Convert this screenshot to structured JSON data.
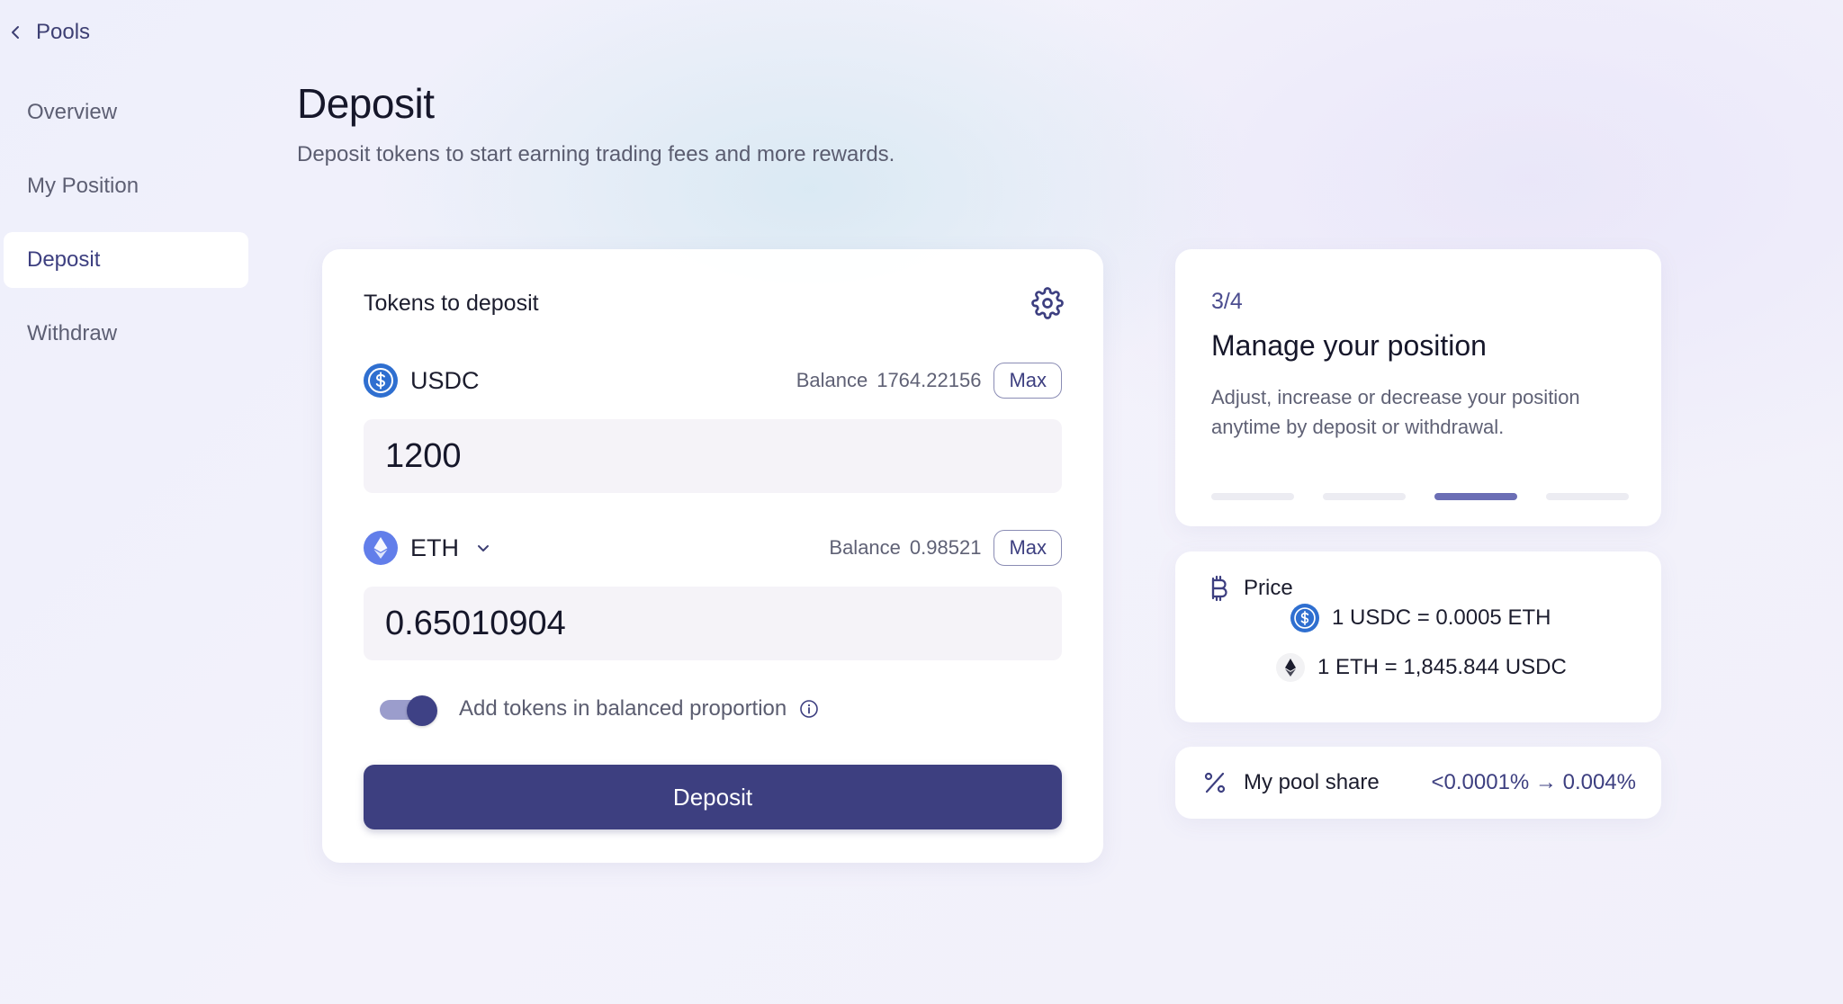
{
  "nav": {
    "back_label": "Pools",
    "items": [
      {
        "label": "Overview",
        "active": false
      },
      {
        "label": "My Position",
        "active": false
      },
      {
        "label": "Deposit",
        "active": true
      },
      {
        "label": "Withdraw",
        "active": false
      }
    ]
  },
  "header": {
    "title": "Deposit",
    "subtitle": "Deposit tokens to start earning trading fees and more rewards."
  },
  "deposit_card": {
    "heading": "Tokens to deposit",
    "token_a": {
      "symbol": "USDC",
      "balance_label": "Balance",
      "balance": "1764.22156",
      "max_label": "Max",
      "amount": "1200",
      "icon": "usdc-icon"
    },
    "token_b": {
      "symbol": "ETH",
      "balance_label": "Balance",
      "balance": "0.98521",
      "max_label": "Max",
      "amount": "0.65010904",
      "icon": "eth-icon"
    },
    "balanced_label": "Add tokens in balanced proportion",
    "balanced_enabled": true,
    "deposit_button": "Deposit"
  },
  "step_card": {
    "step": "3/4",
    "title": "Manage your position",
    "description": "Adjust, increase or decrease your position anytime by deposit or withdrawal.",
    "total_steps": 4,
    "current_step": 3
  },
  "price_card": {
    "title": "Price",
    "rate_1": "1 USDC = 0.0005 ETH",
    "rate_2": "1 ETH = 1,845.844 USDC"
  },
  "share_card": {
    "label": "My pool share",
    "value": "<0.0001% → 0.004%"
  },
  "colors": {
    "accent": "#3d3f80",
    "usdc": "#2f6fd0",
    "eth": "#627eea",
    "progress_active": "#6b6eb5"
  }
}
